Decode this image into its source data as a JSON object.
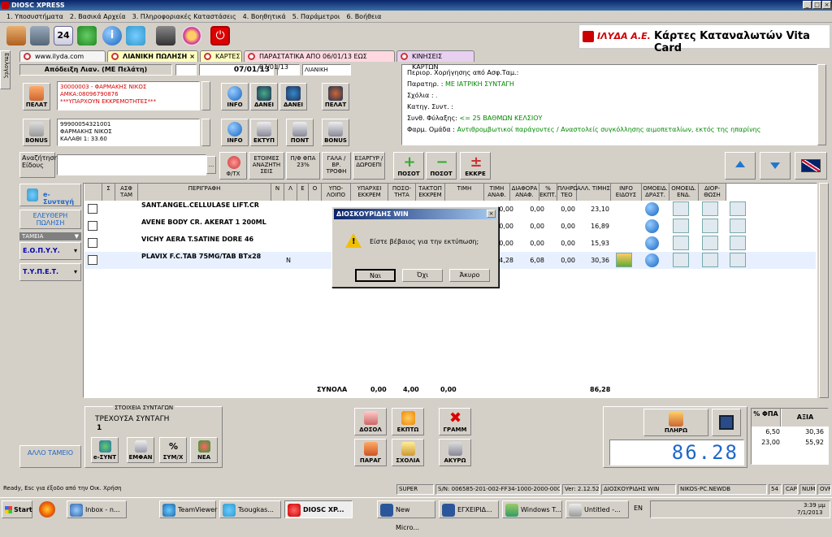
{
  "window": {
    "title": "DIOSC XPRESS"
  },
  "menu": [
    "1. Υποσυστήματα",
    "2. Βασικά Αρχεία",
    "3. Πληροφοριακές Καταστάσεις",
    "4. Βοηθητικά",
    "5. Παράμετροι",
    "6. Βοήθεια"
  ],
  "brand": {
    "logo": "ΙΛΥΔΑ Α.Ε.",
    "title": "Κάρτες Καταναλωτών Vita Card"
  },
  "side_tab": "Επιλογές",
  "tabs": [
    "www.ilyda.com",
    "ΛΙΑΝΙΚΗ ΠΩΛΗΣΗ",
    "ΚΑΡΤΕΣ",
    "ΠΑΡΑΣΤΑΤΙΚΑ ΑΠΟ 06/01/13  ΕΩΣ 07/01/13",
    "ΚΙΝΗΣΕΙΣ ΚΑΡΤΩΝ"
  ],
  "doc": {
    "type": "Απόδειξη Λιαν. (ΜΕ Πελάτη)",
    "date": "07/01/13",
    "kind": "ΛΙΑΝΙΚΗ"
  },
  "customer": {
    "line1": "30000003 - ΦΑΡΜΑΚΗΣ ΝΙΚΟΣ",
    "line2": "ΑΜΚΑ:08096790876",
    "line3": "***ΥΠΑΡΧΟΥΝ ΕΚΚΡΕΜΟΤΗΤΕΣ***",
    "btn": "ΠΕΛΑΤ"
  },
  "bonus": {
    "line1": "99900054321001",
    "line2": "ΦΑΡΜΑΚΗΣ ΝΙΚΟΣ",
    "line3": "ΚΑΛΑΘΙ 1: 33.60",
    "btn": "BONUS"
  },
  "cust_buttons": [
    "INFO",
    "ΔΑΝΕΙ",
    "ΔΑΝΕΙ",
    "ΠΕΛΑΤ"
  ],
  "bonus_buttons": [
    "INFO",
    "ΕΚΤΥΠ",
    "ΠΟΝΤ",
    "BONUS"
  ],
  "info_panel": [
    {
      "k": "Περιορ. Χορήγησης από Ασφ.Ταμ.:",
      "v": ""
    },
    {
      "k": "Παρατηρ. :",
      "v": "ΜΕ ΙΑΤΡΙΚΗ ΣΥΝΤΑΓΗ"
    },
    {
      "k": "Σχόλια :",
      "v": "."
    },
    {
      "k": "Κατηγ. Συντ. :",
      "v": ""
    },
    {
      "k": "Συνθ. Φύλαξης:",
      "v": "<= 25 ΒΑΘΜΩΝ ΚΕΛΣΙΟΥ"
    },
    {
      "k": "Φαρμ. Ομάδα :",
      "v": "Αντιθρομβωτικοί παράγοντες / Αναστολείς συγκόλλησης  αιμοπεταλίων, εκτός της ηπαρίνης"
    }
  ],
  "search": {
    "label": "Αναζήτηση Είδους",
    "btns": [
      "Φ/ΤΧ",
      "ΕΤΟΙΜΕΣ ΑΝΑΖΗΤΗ ΣΕΙΣ",
      "Π/Φ ΦΠΑ 23%",
      "ΓΑΛΑ / ΒΡ. ΤΡΟΦΗ",
      "ΕΞΑΡΓΥΡ / ΔΩΡΟΕΠΙ"
    ]
  },
  "qty_buttons": [
    "ΠΟΣΟΤ",
    "ΠΟΣΟΤ",
    "ΕΚΚΡΕ"
  ],
  "left_nav": {
    "esyntagi": "e-Συνταγή",
    "free": "ΕΛΕΥΘΕΡΗ ΠΩΛΗΣΗ",
    "tameia": "ΤΑΜΕΙΑ",
    "eopyy": "Ε.Ο.Π.Υ.Υ.",
    "typet": "Τ.Υ.Π.Ε.Τ.",
    "allo": "ΑΛΛΟ ΤΑΜΕΙΟ"
  },
  "columns": [
    "Σ",
    "ΑΣΦ ΤΑΜ",
    "ΠΕΡΙΓΡΑΦΗ",
    "Ν",
    "Λ",
    "Ε",
    "Ο",
    "ΥΠΟ-ΛΟΙΠΟ",
    "ΥΠΑΡΧΕΙ ΕΚΚΡΕΜ",
    "ΠΟΣΟ-ΤΗΤΑ",
    "ΤΑΚΤΟΠ ΕΚΚΡΕΜ",
    "ΤΙΜΗ",
    "ΤΙΜΗ ΑΝΑΦ.",
    "ΔΙΑΦΟΡΑ ΑΝΑΦ.",
    "% ΕΚΠΤ.",
    "ΠΛΗΡΩ-ΤΕΟ",
    "ΑΛΛ. ΤΙΜΗΣ",
    "INFO ΕΙΔΟΥΣ",
    "ΟΜΟΕΙΔ. ΔΡΑΣΤ.",
    "ΟΜΟΕΙΔ. ΕΝΔ.",
    "ΔΙΟΡ-ΘΩΣΗ"
  ],
  "rows": [
    {
      "desc": "SANT.ANGEL.CELLULASE LIFT.CR",
      "n": "",
      "qty": "1,00",
      "price": "23,10",
      "ref": "0,00",
      "diff": "0,00",
      "disc": "0,00",
      "pay": "23,10"
    },
    {
      "desc": "AVENE BODY CR. AKERAT 1 200ML",
      "n": "",
      "qty": "",
      "price": "",
      "ref": "0,00",
      "diff": "0,00",
      "disc": "0,00",
      "pay": "16,89"
    },
    {
      "desc": "VICHY AERA T.SATINE DORE 46",
      "n": "",
      "qty": "",
      "price": "",
      "ref": "0,00",
      "diff": "0,00",
      "disc": "0,00",
      "pay": "15,93"
    },
    {
      "desc": "PLAVIX F.C.TAB 75MG/TAB BTx28",
      "n": "N",
      "qty": "",
      "price": "",
      "ref": "24,28",
      "diff": "6,08",
      "disc": "0,00",
      "pay": "30,36"
    }
  ],
  "totals": {
    "label": "ΣΥΝΟΛΑ",
    "a": "0,00",
    "qty": "4,00",
    "c": "0,00",
    "pay": "86,28"
  },
  "rx": {
    "title": "ΣΤΟΙΧΕΙΑ ΣΥΝΤΑΓΩΝ",
    "current": "ΤΡΕΧΟΥΣΑ ΣΥΝΤΑΓΗ",
    "num": "1",
    "btns": [
      "e-ΣΥΝΤ",
      "ΕΜΦΑΝ",
      "ΣΥΜ/Χ",
      "ΝΕΑ"
    ]
  },
  "action_btns": [
    "ΔΟΣΟΛ",
    "ΕΚΠΤΩ",
    "ΓΡΑΜΜ",
    "ΠΑΡΑΓ",
    "ΣΧΟΛΙΑ",
    "ΑΚΥΡΩ"
  ],
  "pay": {
    "btn": "ΠΛΗΡΩ",
    "display": "86.28"
  },
  "vat": {
    "h1": "% ΦΠΑ",
    "h2": "ΑΞΙΑ",
    "rows": [
      [
        "6,50",
        "30,36"
      ],
      [
        "23,00",
        "55,92"
      ]
    ]
  },
  "dialog": {
    "title": "ΔΙΟΣΚΟΥΡΙΔΗΣ WIN",
    "message": "Είστε βέβαιος για την εκτύπωση;",
    "yes": "Ναι",
    "no": "Όχι",
    "cancel": "Άκυρο"
  },
  "status": {
    "msg": "Ready, Esc για έξοδο από την Οικ. Χρήση",
    "mode": "SUPER",
    "sn": "S/N: 006585-201-002-FF34-1000-2000-0000",
    "ver": "Ver: 2.12.52",
    "app": "ΔΙΟΣΚΟΥΡΙΔΗΣ WIN",
    "db": "NIKOS-PC.NEWDB",
    "n": "54",
    "caps": "CAP",
    "num": "NUM",
    "ovr": "OVR"
  },
  "taskbar": {
    "start": "Start",
    "items": [
      "Inbox - n...",
      "TeamViewer",
      "Tsougkas...",
      "DIOSC XP...",
      "New Micro...",
      "ΕΓΧΕΙΡΙΔ...",
      "Windows T...",
      "Untitled -..."
    ],
    "lang": "EN",
    "time": "3:39 μμ",
    "date": "7/1/2013"
  },
  "colors": {
    "accent": "#0a246a",
    "pay_display": "#1e66c8",
    "red_text": "#d40000"
  }
}
